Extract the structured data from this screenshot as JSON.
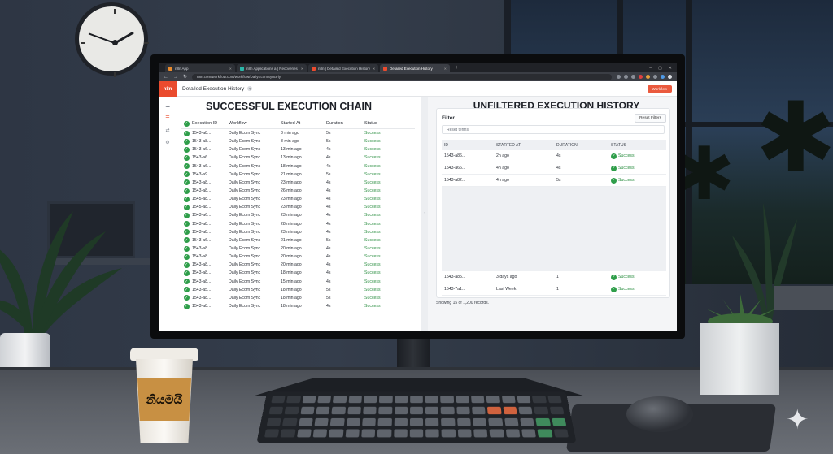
{
  "browser": {
    "tabs": [
      {
        "label": "n8n App",
        "color": "#e88a2e"
      },
      {
        "label": "n8n Applications a | Recoveries",
        "color": "#2bb6a8"
      },
      {
        "label": "n8n | Detailed Execution History",
        "color": "#ea4b2e"
      },
      {
        "label": "Detailed Execution History",
        "color": "#ea4b2e"
      }
    ],
    "url": "n8n.com/workflow.com/workflow/DailyEcomSyncFly",
    "new_tab": "+",
    "window_controls": [
      "–",
      "▢",
      "✕"
    ]
  },
  "app": {
    "logo": "n8n",
    "page_title": "Detailed Execution History",
    "help": "?",
    "workflow_button": "Workflow"
  },
  "left": {
    "heading": "SUCCESSFUL EXECUTION CHAIN",
    "columns": [
      "Execution ID",
      "Workflow",
      "Started At",
      "Duration",
      "Status"
    ],
    "rows": [
      [
        "1543-a8...",
        "Daily Ecom Sync",
        "3 min ago",
        "5s",
        "Success"
      ],
      [
        "1543-a8...",
        "Daily Ecom Sync",
        "8 min ago",
        "5s",
        "Success"
      ],
      [
        "1543-a6...",
        "Daily Ecom Sync",
        "13 min ago",
        "4s",
        "Success"
      ],
      [
        "1543-a6...",
        "Daily Ecom Sync",
        "13 min ago",
        "4s",
        "Success"
      ],
      [
        "1543-a6...",
        "Daily Ecom Sync",
        "18 min ago",
        "4s",
        "Success"
      ],
      [
        "1543-a9...",
        "Daily Ecom Sync",
        "21 min ago",
        "5s",
        "Success"
      ],
      [
        "1543-a8...",
        "Daily Ecom Sync",
        "23 min ago",
        "4s",
        "Success"
      ],
      [
        "1543-a8...",
        "Daily Ecom Sync",
        "26 min ago",
        "4s",
        "Success"
      ],
      [
        "1545-a8...",
        "Daily Ecom Sync",
        "23 min ago",
        "4s",
        "Success"
      ],
      [
        "1545-a8...",
        "Daily Ecom Sync",
        "23 min ago",
        "4s",
        "Success"
      ],
      [
        "1543-a6...",
        "Daily Ecom Sync",
        "23 min ago",
        "4s",
        "Success"
      ],
      [
        "1543-a8...",
        "Daily Ecom Sync",
        "28 min ago",
        "4s",
        "Success"
      ],
      [
        "1543-a8...",
        "Daily Ecom Sync",
        "23 min ago",
        "4s",
        "Success"
      ],
      [
        "1543-a6...",
        "Daily Ecom Sync",
        "21 min ago",
        "5s",
        "Success"
      ],
      [
        "1543-a8...",
        "Daily Ecom Sync",
        "20 min ago",
        "4s",
        "Success"
      ],
      [
        "1543-a8...",
        "Daily Ecom Sync",
        "20 min ago",
        "4s",
        "Success"
      ],
      [
        "1543-a8...",
        "Daily Ecom Sync",
        "20 min ago",
        "4s",
        "Success"
      ],
      [
        "1543-a8...",
        "Daily Ecom Sync",
        "18 min ago",
        "4s",
        "Success"
      ],
      [
        "1543-a8...",
        "Daily Ecom Sync",
        "15 min ago",
        "4s",
        "Success"
      ],
      [
        "1543-a5...",
        "Daily Ecom Sync",
        "18 min ago",
        "5s",
        "Success"
      ],
      [
        "1543-a8...",
        "Daily Ecom Sync",
        "18 min ago",
        "5s",
        "Success"
      ],
      [
        "1543-a8...",
        "Daily Ecom Sync",
        "18 min ago",
        "4s",
        "Success"
      ]
    ]
  },
  "right": {
    "heading": "UNFILTERED EXECUTION HISTORY",
    "filter_label": "Filter",
    "reset_filters": "Reset Filters",
    "reset_terms_placeholder": "Reset terms",
    "columns": [
      "ID",
      "STARTED AT",
      "DURATION",
      "STATUS"
    ],
    "rows_top": [
      [
        "1543-a86...",
        "2h ago",
        "4s",
        "Success"
      ],
      [
        "1543-a66...",
        "4h ago",
        "4s",
        "Success"
      ],
      [
        "1543-a82...",
        "4h ago",
        "5s",
        "Success"
      ]
    ],
    "rows_bottom": [
      [
        "1543-a85...",
        "3 days ago",
        "1",
        "Success"
      ],
      [
        "1543-7a1...",
        "Last Week",
        "1",
        "Success"
      ]
    ],
    "showing": "Showing 15 of 1,200 records."
  },
  "cup_label": "නියමයි",
  "colors": {
    "accent": "#ea4b2e",
    "success": "#2f9e4a"
  }
}
